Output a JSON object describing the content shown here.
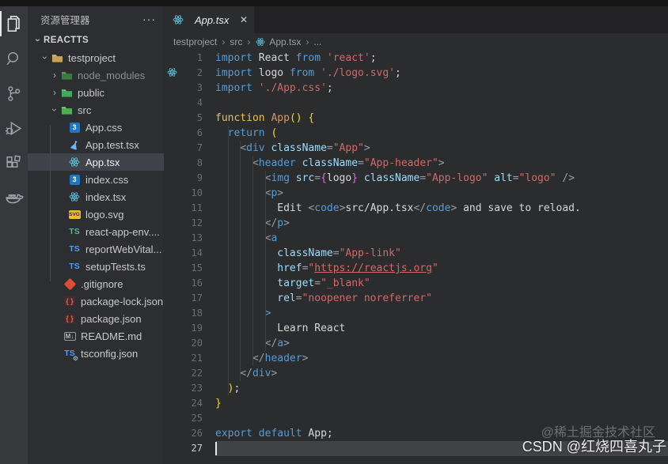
{
  "colors": {
    "editor_bg": "#2b2c2e",
    "sidebar_bg": "#2d2e31",
    "activity_bg": "#37383b",
    "selection_bg": "#404349",
    "current_line_bg": "#414246",
    "react_blue": "#58c4dc",
    "keyword_blue": "#569cd6",
    "string_red": "#d16969",
    "bracket_gold": "#ffd700",
    "brace_orchid": "#da70d6"
  },
  "activity_bar": {
    "items": [
      {
        "name": "explorer",
        "active": true
      },
      {
        "name": "search",
        "active": false
      },
      {
        "name": "source-control",
        "active": false
      },
      {
        "name": "run-and-debug",
        "active": false
      },
      {
        "name": "extensions",
        "active": false
      },
      {
        "name": "docker",
        "active": false
      }
    ]
  },
  "explorer": {
    "title": "资源管理器",
    "actions_label": "···",
    "section_label": "REACTTS",
    "tree": [
      {
        "label": "testproject",
        "icon": "folder-open-tan",
        "chevron": "down",
        "indent": 15
      },
      {
        "label": "node_modules",
        "icon": "folder-node",
        "chevron": "right",
        "indent": 27,
        "dim": true
      },
      {
        "label": "public",
        "icon": "folder-public",
        "chevron": "right",
        "indent": 27
      },
      {
        "label": "src",
        "icon": "folder-src",
        "chevron": "down",
        "indent": 27
      },
      {
        "label": "App.css",
        "icon": "css3",
        "indent": 51
      },
      {
        "label": "App.test.tsx",
        "icon": "test-flask",
        "indent": 51
      },
      {
        "label": "App.tsx",
        "icon": "react",
        "indent": 51,
        "selected": true
      },
      {
        "label": "index.css",
        "icon": "css3",
        "indent": 51
      },
      {
        "label": "index.tsx",
        "icon": "react",
        "indent": 51
      },
      {
        "label": "logo.svg",
        "icon": "svg-badge",
        "indent": 51
      },
      {
        "label": "react-app-env....",
        "icon": "ts-green",
        "indent": 51
      },
      {
        "label": "reportWebVital...",
        "icon": "ts",
        "indent": 51
      },
      {
        "label": "setupTests.ts",
        "icon": "ts",
        "indent": 51
      },
      {
        "label": ".gitignore",
        "icon": "git",
        "indent": 45
      },
      {
        "label": "package-lock.json",
        "icon": "json",
        "indent": 45
      },
      {
        "label": "package.json",
        "icon": "json",
        "indent": 45
      },
      {
        "label": "README.md",
        "icon": "markdown",
        "indent": 45
      },
      {
        "label": "tsconfig.json",
        "icon": "ts-config",
        "indent": 45
      }
    ]
  },
  "tab": {
    "title": "App.tsx",
    "close_label": "✕",
    "icon": "react"
  },
  "breadcrumb": {
    "items": [
      "testproject",
      "src",
      "App.tsx",
      "..."
    ]
  },
  "editor": {
    "active_line": 27,
    "glyph_react_line": 2,
    "lines": [
      [
        [
          "import",
          "kw"
        ],
        [
          " React ",
          "tx"
        ],
        [
          "from",
          "kw"
        ],
        [
          " ",
          "tx"
        ],
        [
          "'react'",
          "str"
        ],
        [
          ";",
          "tx"
        ]
      ],
      [
        [
          "import",
          "kw"
        ],
        [
          " logo ",
          "tx"
        ],
        [
          "from",
          "kw"
        ],
        [
          " ",
          "tx"
        ],
        [
          "'./logo.svg'",
          "str"
        ],
        [
          ";",
          "tx"
        ]
      ],
      [
        [
          "import",
          "kw"
        ],
        [
          " ",
          "tx"
        ],
        [
          "'./App.css'",
          "str"
        ],
        [
          ";",
          "tx"
        ]
      ],
      [],
      [
        [
          "function",
          "st"
        ],
        [
          " ",
          "tx"
        ],
        [
          "App",
          "fn"
        ],
        [
          "()",
          "b1"
        ],
        [
          " ",
          "tx"
        ],
        [
          "{",
          "b1"
        ]
      ],
      [
        [
          "  ",
          "tx"
        ],
        [
          "return",
          "kw"
        ],
        [
          " ",
          "tx"
        ],
        [
          "(",
          "b1"
        ]
      ],
      [
        [
          "    ",
          "tx"
        ],
        [
          "<",
          "pn"
        ],
        [
          "div",
          "tag"
        ],
        [
          " ",
          "tx"
        ],
        [
          "className",
          "attr"
        ],
        [
          "=",
          "pn"
        ],
        [
          "\"App\"",
          "str"
        ],
        [
          ">",
          "pn"
        ]
      ],
      [
        [
          "      ",
          "tx"
        ],
        [
          "<",
          "pn"
        ],
        [
          "header",
          "tag"
        ],
        [
          " ",
          "tx"
        ],
        [
          "className",
          "attr"
        ],
        [
          "=",
          "pn"
        ],
        [
          "\"App-header\"",
          "str"
        ],
        [
          ">",
          "pn"
        ]
      ],
      [
        [
          "        ",
          "tx"
        ],
        [
          "<",
          "pn"
        ],
        [
          "img",
          "tag"
        ],
        [
          " ",
          "tx"
        ],
        [
          "src",
          "attr"
        ],
        [
          "=",
          "pn"
        ],
        [
          "{",
          "b2"
        ],
        [
          "logo",
          "tx"
        ],
        [
          "}",
          "b2"
        ],
        [
          " ",
          "tx"
        ],
        [
          "className",
          "attr"
        ],
        [
          "=",
          "pn"
        ],
        [
          "\"App-logo\"",
          "str"
        ],
        [
          " ",
          "tx"
        ],
        [
          "alt",
          "attr"
        ],
        [
          "=",
          "pn"
        ],
        [
          "\"logo\"",
          "str"
        ],
        [
          " ",
          "tx"
        ],
        [
          "/>",
          "pn"
        ]
      ],
      [
        [
          "        ",
          "tx"
        ],
        [
          "<",
          "pn"
        ],
        [
          "p",
          "tag"
        ],
        [
          ">",
          "pn"
        ]
      ],
      [
        [
          "          ",
          "tx"
        ],
        [
          "Edit ",
          "tx"
        ],
        [
          "<",
          "pn"
        ],
        [
          "code",
          "tag"
        ],
        [
          ">",
          "pn"
        ],
        [
          "src/App.tsx",
          "tx"
        ],
        [
          "</",
          "pn"
        ],
        [
          "code",
          "tag"
        ],
        [
          ">",
          "pn"
        ],
        [
          " and save to reload.",
          "tx"
        ]
      ],
      [
        [
          "        ",
          "tx"
        ],
        [
          "</",
          "pn"
        ],
        [
          "p",
          "tag"
        ],
        [
          ">",
          "pn"
        ]
      ],
      [
        [
          "        ",
          "tx"
        ],
        [
          "<",
          "pn"
        ],
        [
          "a",
          "tag"
        ]
      ],
      [
        [
          "          ",
          "tx"
        ],
        [
          "className",
          "attr"
        ],
        [
          "=",
          "pn"
        ],
        [
          "\"App-link\"",
          "str"
        ]
      ],
      [
        [
          "          ",
          "tx"
        ],
        [
          "href",
          "attr"
        ],
        [
          "=",
          "pn"
        ],
        [
          "\"",
          "str"
        ],
        [
          "https://reactjs.org",
          "lnk"
        ],
        [
          "\"",
          "str"
        ]
      ],
      [
        [
          "          ",
          "tx"
        ],
        [
          "target",
          "attr"
        ],
        [
          "=",
          "pn"
        ],
        [
          "\"_blank\"",
          "str"
        ]
      ],
      [
        [
          "          ",
          "tx"
        ],
        [
          "rel",
          "attr"
        ],
        [
          "=",
          "pn"
        ],
        [
          "\"noopener noreferrer\"",
          "str"
        ]
      ],
      [
        [
          "        ",
          "tx"
        ],
        [
          ">",
          "tag"
        ]
      ],
      [
        [
          "          ",
          "tx"
        ],
        [
          "Learn React",
          "tx"
        ]
      ],
      [
        [
          "        ",
          "tx"
        ],
        [
          "</",
          "pn"
        ],
        [
          "a",
          "tag"
        ],
        [
          ">",
          "pn"
        ]
      ],
      [
        [
          "      ",
          "tx"
        ],
        [
          "</",
          "pn"
        ],
        [
          "header",
          "tag"
        ],
        [
          ">",
          "pn"
        ]
      ],
      [
        [
          "    ",
          "tx"
        ],
        [
          "</",
          "pn"
        ],
        [
          "div",
          "tag"
        ],
        [
          ">",
          "pn"
        ]
      ],
      [
        [
          "  ",
          "tx"
        ],
        [
          ")",
          "b1"
        ],
        [
          ";",
          "tx"
        ]
      ],
      [
        [
          "}",
          "b1"
        ]
      ],
      [],
      [
        [
          "export",
          "kw"
        ],
        [
          " ",
          "tx"
        ],
        [
          "default",
          "kw"
        ],
        [
          " App",
          "tx"
        ],
        [
          ";",
          "tx"
        ]
      ],
      []
    ]
  },
  "watermarks": {
    "juejin": "@稀土掘金技术社区",
    "csdn": "CSDN @红烧四喜丸子"
  }
}
